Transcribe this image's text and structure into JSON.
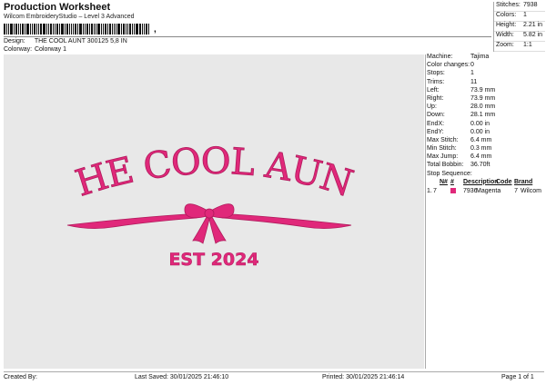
{
  "header": {
    "title": "Production Worksheet",
    "software": "Wilcom EmbroideryStudio – Level 3 Advanced",
    "design_label": "Design:",
    "design_value": "THE COOL AUNT 300125 5,8 IN",
    "colorway_label": "Colorway:",
    "colorway_value": "Colorway 1"
  },
  "stats": [
    {
      "label": "Stitches:",
      "value": "7938"
    },
    {
      "label": "Colors:",
      "value": "1"
    },
    {
      "label": "Height:",
      "value": "2.21 in"
    },
    {
      "label": "Width:",
      "value": "5.82 in"
    },
    {
      "label": "Zoom:",
      "value": "1:1"
    }
  ],
  "details": [
    {
      "label": "Machine:",
      "value": "Tajima"
    },
    {
      "label": "Color changes:",
      "value": "0"
    },
    {
      "label": "Stops:",
      "value": "1"
    },
    {
      "label": "Trims:",
      "value": "11"
    },
    {
      "label": "Left:",
      "value": "73.9 mm"
    },
    {
      "label": "Right:",
      "value": "73.9 mm"
    },
    {
      "label": "Up:",
      "value": "28.0 mm"
    },
    {
      "label": "Down:",
      "value": "28.1 mm"
    },
    {
      "label": "EndX:",
      "value": "0.00 in"
    },
    {
      "label": "EndY:",
      "value": "0.00 in"
    },
    {
      "label": "Max Stitch:",
      "value": "6.4 mm"
    },
    {
      "label": "Min Stitch:",
      "value": "0.3 mm"
    },
    {
      "label": "Max Jump:",
      "value": "6.4 mm"
    },
    {
      "label": "Total Bobbin:",
      "value": "36.70ft"
    }
  ],
  "stop_sequence": {
    "title": "Stop Sequence:",
    "columns": [
      "N#",
      "#",
      "Description",
      "Code",
      "Brand"
    ],
    "rows": [
      {
        "stop": "1.",
        "n": "7",
        "count": "7936",
        "description": "Magenta",
        "code": "7",
        "brand": "Wilcom",
        "color": "#e0287a"
      }
    ]
  },
  "design": {
    "line1": "THE COOL AUNT",
    "line2": "EST 2024",
    "thread_color": "#e0287a",
    "canvas_color": "#e8e8e8"
  },
  "footer": {
    "created_by": "Created By:",
    "last_saved": "Last Saved: 30/01/2025 21:46:10",
    "printed": "Printed: 30/01/2025 21:46:14",
    "page": "Page 1 of 1"
  }
}
